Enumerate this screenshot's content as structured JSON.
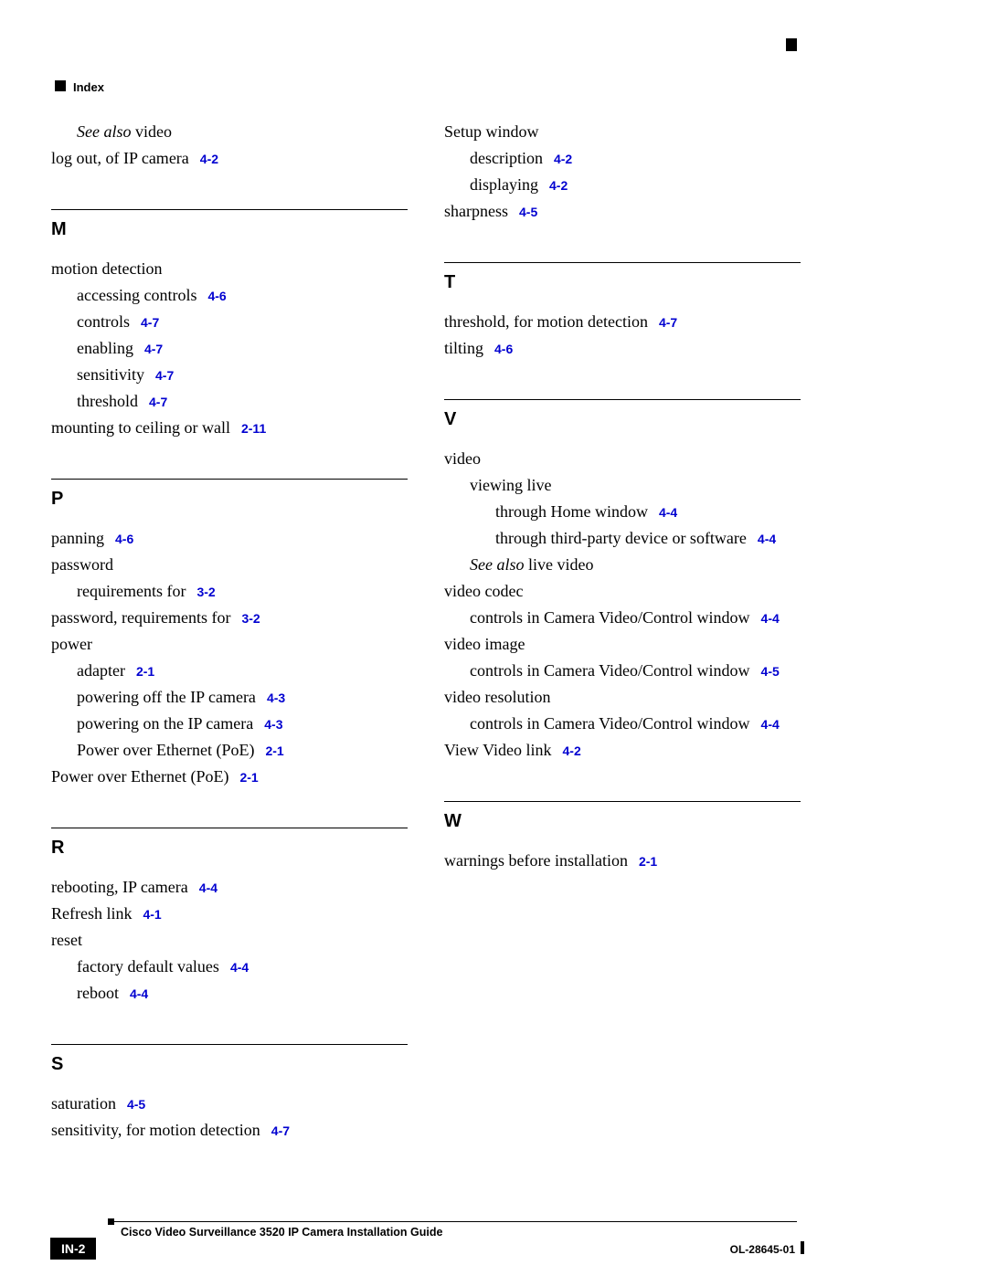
{
  "header": {
    "label": "Index"
  },
  "footer": {
    "title": "Cisco Video Surveillance 3520 IP Camera Installation Guide",
    "page": "IN-2",
    "docnum": "OL-28645-01"
  },
  "left": {
    "pre": [
      {
        "type": "seealso",
        "pre": "See also ",
        "post": "video",
        "indent": 1
      },
      {
        "text": "log out, of IP camera",
        "ref": "4-2",
        "indent": 0
      }
    ],
    "sections": [
      {
        "letter": "M",
        "entries": [
          {
            "text": "motion detection",
            "indent": 0
          },
          {
            "text": "accessing controls",
            "ref": "4-6",
            "indent": 1
          },
          {
            "text": "controls",
            "ref": "4-7",
            "indent": 1
          },
          {
            "text": "enabling",
            "ref": "4-7",
            "indent": 1
          },
          {
            "text": "sensitivity",
            "ref": "4-7",
            "indent": 1
          },
          {
            "text": "threshold",
            "ref": "4-7",
            "indent": 1
          },
          {
            "text": "mounting to ceiling or wall",
            "ref": "2-11",
            "indent": 0
          }
        ]
      },
      {
        "letter": "P",
        "entries": [
          {
            "text": "panning",
            "ref": "4-6",
            "indent": 0
          },
          {
            "text": "password",
            "indent": 0
          },
          {
            "text": "requirements for",
            "ref": "3-2",
            "indent": 1
          },
          {
            "text": "password, requirements for",
            "ref": "3-2",
            "indent": 0
          },
          {
            "text": "power",
            "indent": 0
          },
          {
            "text": "adapter",
            "ref": "2-1",
            "indent": 1
          },
          {
            "text": "powering off the IP camera",
            "ref": "4-3",
            "indent": 1
          },
          {
            "text": "powering on the IP camera",
            "ref": "4-3",
            "indent": 1
          },
          {
            "text": "Power over Ethernet (PoE)",
            "ref": "2-1",
            "indent": 1
          },
          {
            "text": "Power over Ethernet (PoE)",
            "ref": "2-1",
            "indent": 0
          }
        ]
      },
      {
        "letter": "R",
        "entries": [
          {
            "text": "rebooting, IP camera",
            "ref": "4-4",
            "indent": 0
          },
          {
            "text": "Refresh link",
            "ref": "4-1",
            "indent": 0
          },
          {
            "text": "reset",
            "indent": 0
          },
          {
            "text": "factory default values",
            "ref": "4-4",
            "indent": 1
          },
          {
            "text": "reboot",
            "ref": "4-4",
            "indent": 1
          }
        ]
      },
      {
        "letter": "S",
        "entries": [
          {
            "text": "saturation",
            "ref": "4-5",
            "indent": 0
          },
          {
            "text": "sensitivity, for motion detection",
            "ref": "4-7",
            "indent": 0
          }
        ]
      }
    ]
  },
  "right": {
    "pre": [
      {
        "text": "Setup window",
        "indent": 0
      },
      {
        "text": "description",
        "ref": "4-2",
        "indent": 1
      },
      {
        "text": "displaying",
        "ref": "4-2",
        "indent": 1
      },
      {
        "text": "sharpness",
        "ref": "4-5",
        "indent": 0
      }
    ],
    "sections": [
      {
        "letter": "T",
        "entries": [
          {
            "text": "threshold, for motion detection",
            "ref": "4-7",
            "indent": 0
          },
          {
            "text": "tilting",
            "ref": "4-6",
            "indent": 0
          }
        ]
      },
      {
        "letter": "V",
        "entries": [
          {
            "text": "video",
            "indent": 0
          },
          {
            "text": "viewing live",
            "indent": 1
          },
          {
            "text": "through Home window",
            "ref": "4-4",
            "indent": 2
          },
          {
            "text": "through third-party device or software",
            "ref": "4-4",
            "indent": 2
          },
          {
            "type": "seealso",
            "pre": "See also ",
            "post": "live video",
            "indent": 1
          },
          {
            "text": "video codec",
            "indent": 0
          },
          {
            "text": "controls in Camera Video/Control window",
            "ref": "4-4",
            "indent": 1
          },
          {
            "text": "video image",
            "indent": 0
          },
          {
            "text": "controls in Camera Video/Control window",
            "ref": "4-5",
            "indent": 1
          },
          {
            "text": "video resolution",
            "indent": 0
          },
          {
            "text": "controls in Camera Video/Control window",
            "ref": "4-4",
            "indent": 1
          },
          {
            "text": "View Video link",
            "ref": "4-2",
            "indent": 0
          }
        ]
      },
      {
        "letter": "W",
        "entries": [
          {
            "text": "warnings before installation",
            "ref": "2-1",
            "indent": 0
          }
        ]
      }
    ]
  }
}
